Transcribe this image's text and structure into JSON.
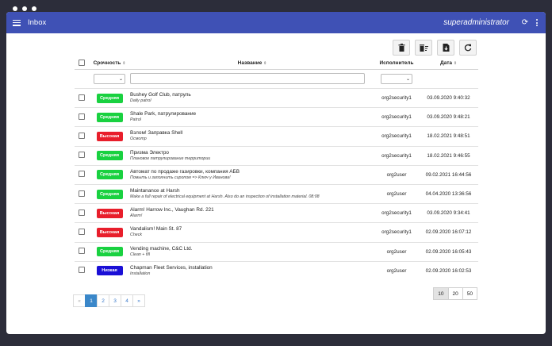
{
  "appbar": {
    "title": "Inbox",
    "user": "superadministrator"
  },
  "table": {
    "headers": {
      "urgency": "Срочность",
      "name": "Название",
      "assignee": "Исполнитель",
      "date": "Дата"
    },
    "rows": [
      {
        "urgency": "Средняя",
        "color": "#19d140",
        "title": "Bushey Golf Club, патруль",
        "sub": "Daily patrol",
        "assignee": "org2security1",
        "date": "03.09.2020 9:40:32"
      },
      {
        "urgency": "Средняя",
        "color": "#19d140",
        "title": "Shale Park, патрулирование",
        "sub": "Patrol",
        "assignee": "org2security1",
        "date": "03.09.2020 9:48:21"
      },
      {
        "urgency": "Высокая",
        "color": "#e81e2b",
        "title": "Взлом! Заправка Shell",
        "sub": "Осмотр",
        "assignee": "org2security1",
        "date": "18.02.2021 9:48:51"
      },
      {
        "urgency": "Средняя",
        "color": "#19d140",
        "title": "Призма Электро",
        "sub": "Плановое патрулирование территории",
        "assignee": "org2security1",
        "date": "18.02.2021 9:46:55"
      },
      {
        "urgency": "Средняя",
        "color": "#19d140",
        "title": "Автомат по продаже газировки, компания АБВ",
        "sub": "Помыть и заполнить сиропом => Ключ у Иванова!",
        "assignee": "org2user",
        "date": "09.02.2021 16:44:56"
      },
      {
        "urgency": "Средняя",
        "color": "#19d140",
        "title": "Maintanance at Harsh",
        "sub": "Make a full repair of electrical equipment at Harsh. Also do an inspection of installation material. 08:08",
        "assignee": "org2user",
        "date": "04.04.2020 13:36:56"
      },
      {
        "urgency": "Высокая",
        "color": "#e81e2b",
        "title": "Alarm! Harrow Inc., Vaughan Rd. 221",
        "sub": "Alarm!",
        "assignee": "org2security1",
        "date": "03.09.2020 9:34:41"
      },
      {
        "urgency": "Высокая",
        "color": "#e81e2b",
        "title": "Vandalism! Main St. 87",
        "sub": "Check",
        "assignee": "org2security1",
        "date": "02.09.2020 16:07:12"
      },
      {
        "urgency": "Средняя",
        "color": "#19d140",
        "title": "Vending machine, C&C Ltd.",
        "sub": "Clean + fill",
        "assignee": "org2user",
        "date": "02.09.2020 16:05:43"
      },
      {
        "urgency": "Низкая",
        "color": "#1a0fd6",
        "title": "Chapman Fleet Services, installation",
        "sub": "Installation",
        "assignee": "org2user",
        "date": "02.09.2020 16:02:53"
      }
    ]
  },
  "pagination": {
    "prev": "«",
    "pages": [
      "1",
      "2",
      "3",
      "4"
    ],
    "next": "»",
    "current": "1"
  },
  "page_sizes": [
    "10",
    "20",
    "50"
  ],
  "page_size_selected": "10"
}
